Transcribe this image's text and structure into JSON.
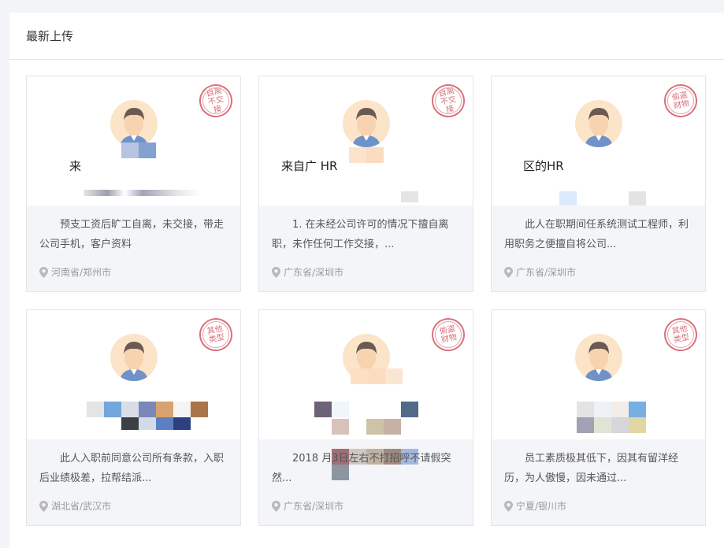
{
  "header": {
    "title": "最新上传"
  },
  "cards": [
    {
      "stamp": "自离不交接",
      "title": "来",
      "desc": "预支工资后旷工自离，未交接，带走公司手机，客户资料",
      "location": "河南省/郑州市"
    },
    {
      "stamp": "自离不交接",
      "title": "来自广                                    HR",
      "desc": "1. 在未经公司许可的情况下擅自离职，未作任何工作交接，...",
      "location": "广东省/深圳市"
    },
    {
      "stamp": "偷盗财物",
      "title": "                    区的HR",
      "desc": "此人在职期间任系统测试工程师，利用职务之便擅自将公司...",
      "location": "广东省/深圳市"
    },
    {
      "stamp": "其他类型",
      "title": "",
      "desc": "此人入职前同意公司所有条款，入职后业绩极差，拉帮结派...",
      "location": "湖北省/武汉市"
    },
    {
      "stamp": "偷盗财物",
      "title": "",
      "desc": "2018                               月3日左右不打招呼不请假突然...",
      "location": "广东省/深圳市"
    },
    {
      "stamp": "其他类型",
      "title": "",
      "desc": "员工素质极其低下，因其有留洋经历，为人傲慢，因未通过...",
      "location": "宁夏/银川市"
    }
  ]
}
